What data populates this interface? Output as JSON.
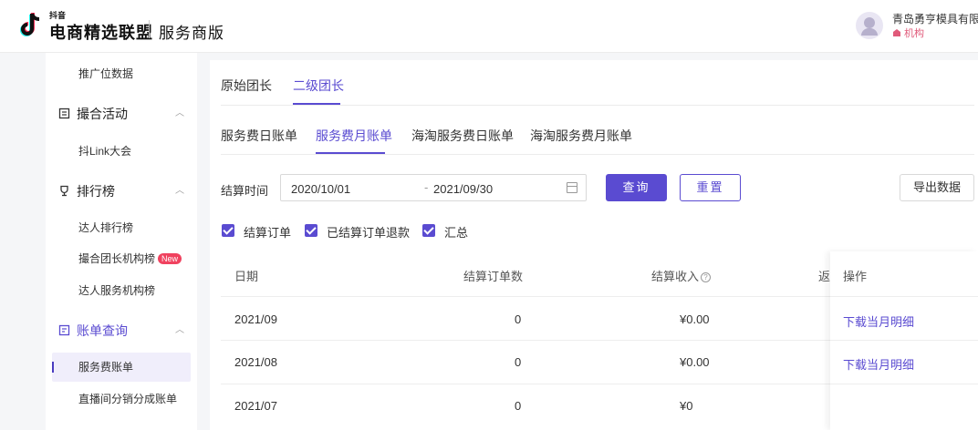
{
  "header": {
    "logo_small": "抖音",
    "logo_main": "电商精选联盟",
    "logo_sub": "服务商版",
    "company": "青岛勇亨模具有限公",
    "org_tag": "机构"
  },
  "sidebar": {
    "items": [
      {
        "type": "sub",
        "label": "推广位数据"
      },
      {
        "type": "group",
        "label": "撮合活动",
        "icon": "document-icon"
      },
      {
        "type": "sub",
        "label": "抖Link大会"
      },
      {
        "type": "group",
        "label": "排行榜",
        "icon": "trophy-icon"
      },
      {
        "type": "sub",
        "label": "达人排行榜"
      },
      {
        "type": "sub",
        "label": "撮合团长机构榜",
        "badge": "New"
      },
      {
        "type": "sub",
        "label": "达人服务机构榜"
      },
      {
        "type": "group",
        "label": "账单查询",
        "icon": "bill-icon"
      },
      {
        "type": "sub",
        "label": "服务费账单",
        "active": true
      },
      {
        "type": "sub",
        "label": "直播间分销分成账单"
      }
    ]
  },
  "tabs_primary": [
    {
      "label": "原始团长",
      "active": false
    },
    {
      "label": "二级团长",
      "active": true
    }
  ],
  "tabs_secondary": [
    {
      "label": "服务费日账单",
      "active": false
    },
    {
      "label": "服务费月账单",
      "active": true
    },
    {
      "label": "海淘服务费日账单",
      "active": false
    },
    {
      "label": "海淘服务费月账单",
      "active": false
    }
  ],
  "filter": {
    "label": "结算时间",
    "date_start": "2020/10/01",
    "date_sep": "-",
    "date_end": "2021/09/30",
    "query_button": "查询",
    "reset_button": "重置",
    "export_button": "导出数据"
  },
  "checkboxes": [
    {
      "label": "结算订单",
      "checked": true
    },
    {
      "label": "已结算订单退款",
      "checked": true
    },
    {
      "label": "汇总",
      "checked": true
    }
  ],
  "table": {
    "columns": [
      "日期",
      "结算订单数",
      "结算收入",
      "返",
      "操作"
    ],
    "rows": [
      {
        "date": "2021/09",
        "orders": "0",
        "income": "¥0.00",
        "action": "下载当月明细"
      },
      {
        "date": "2021/08",
        "orders": "0",
        "income": "¥0.00",
        "action": "下载当月明细"
      },
      {
        "date": "2021/07",
        "orders": "0",
        "income": "¥0",
        "action": ""
      }
    ]
  },
  "colors": {
    "accent": "#5a4bd1",
    "badge": "#f0425f"
  }
}
